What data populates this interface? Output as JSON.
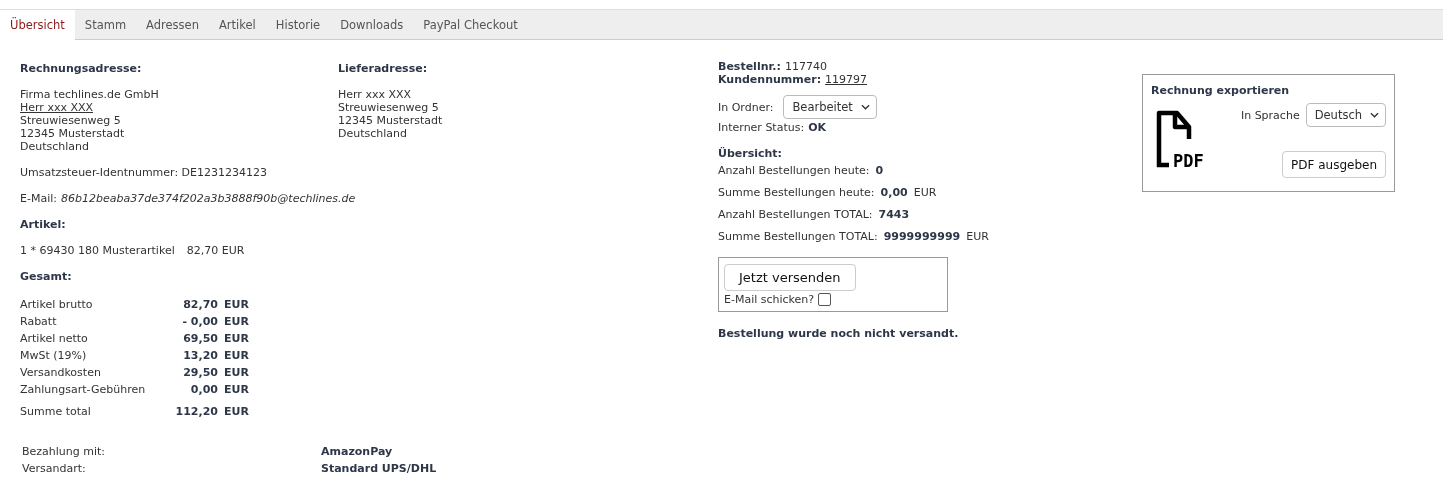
{
  "tabs": [
    {
      "label": "Übersicht",
      "selected": true
    },
    {
      "label": "Stamm",
      "selected": false
    },
    {
      "label": "Adressen",
      "selected": false
    },
    {
      "label": "Artikel",
      "selected": false
    },
    {
      "label": "Historie",
      "selected": false
    },
    {
      "label": "Downloads",
      "selected": false
    },
    {
      "label": "PayPal Checkout",
      "selected": false
    }
  ],
  "billing_address": {
    "heading": "Rechnungsadresse:",
    "lines": [
      {
        "text": "Firma techlines.de GmbH",
        "kind": "text"
      },
      {
        "text": "Herr xxx XXX",
        "kind": "link"
      },
      {
        "text": "Streuwiesenweg 5",
        "kind": "text"
      },
      {
        "text": "12345 Musterstadt",
        "kind": "text"
      },
      {
        "text": "Deutschland",
        "kind": "text"
      }
    ]
  },
  "shipping_address": {
    "heading": "Lieferadresse:",
    "lines": [
      "Herr xxx XXX",
      "Streuwiesenweg 5",
      "12345 Musterstadt",
      "Deutschland"
    ]
  },
  "vat_id": "Umsatzsteuer-Identnummer: DE1231234123",
  "email": {
    "label": "E-Mail:",
    "value": "86b12beaba37de374f202a3b3888f90b@techlines.de"
  },
  "articles": {
    "heading": "Artikel:",
    "items": [
      {
        "description": "1 * 69430 180 Musterartikel",
        "price": "82,70 EUR"
      }
    ]
  },
  "totals": {
    "heading": "Gesamt:",
    "rows": [
      {
        "label": "Artikel brutto",
        "amount": "82,70",
        "currency": "EUR",
        "kind": "line"
      },
      {
        "label": "Rabatt",
        "amount": "- 0,00",
        "currency": "EUR",
        "kind": "line"
      },
      {
        "label": "Artikel netto",
        "amount": "69,50",
        "currency": "EUR",
        "kind": "line"
      },
      {
        "label": "MwSt (19%)",
        "amount": "13,20",
        "currency": "EUR",
        "kind": "line"
      },
      {
        "label": "Versandkosten",
        "amount": "29,50",
        "currency": "EUR",
        "kind": "line"
      },
      {
        "label": "Zahlungsart-Gebühren",
        "amount": "0,00",
        "currency": "EUR",
        "kind": "line"
      },
      {
        "label": "Summe total",
        "amount": "112,20",
        "currency": "EUR",
        "kind": "total"
      }
    ]
  },
  "payment": [
    {
      "label": "Bezahlung mit:",
      "value": "AmazonPay"
    },
    {
      "label": "Versandart:",
      "value": "Standard UPS/DHL"
    }
  ],
  "order": {
    "number_label": "Bestellnr.:",
    "number": "117740",
    "customer_label": "Kundennummer:",
    "customer_number": "119797",
    "folder_label": "In Ordner:",
    "folder": "Bearbeitet",
    "status_label": "Interner Status:",
    "status": "OK"
  },
  "overview": {
    "heading": "Übersicht:",
    "stats": [
      {
        "label": "Anzahl Bestellungen heute:",
        "value": "0"
      },
      {
        "label": "Summe Bestellungen heute:",
        "value": "0,00",
        "unit": "EUR"
      },
      {
        "label": "Anzahl Bestellungen TOTAL:",
        "value": "7443"
      },
      {
        "label": "Summe Bestellungen TOTAL:",
        "value": "9999999999",
        "unit": "EUR"
      }
    ]
  },
  "shipping_box": {
    "button": "Jetzt versenden",
    "checkbox_label": "E-Mail schicken?",
    "checked": false
  },
  "shipping_status": "Bestellung wurde noch nicht versandt.",
  "export": {
    "title": "Rechnung exportieren",
    "icon_label": "PDF",
    "language_label": "In Sprache",
    "language": "Deutsch",
    "button": "PDF ausgeben"
  }
}
